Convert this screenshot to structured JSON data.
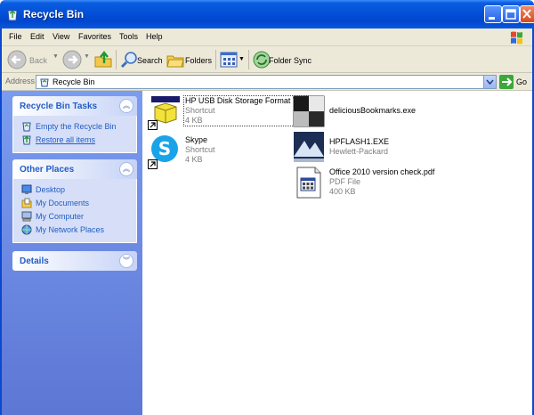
{
  "window": {
    "title": "Recycle Bin"
  },
  "menu": [
    "File",
    "Edit",
    "View",
    "Favorites",
    "Tools",
    "Help"
  ],
  "toolbar": {
    "back_label": "Back",
    "search_label": "Search",
    "folders_label": "Folders",
    "folder_sync_label": "Folder Sync"
  },
  "address": {
    "label": "Address",
    "value": "Recycle Bin",
    "go_label": "Go"
  },
  "taskpane": {
    "recycle_tasks": {
      "title": "Recycle Bin Tasks",
      "items": [
        {
          "label": "Empty the Recycle Bin",
          "icon": "empty-bin-icon"
        },
        {
          "label": "Restore all items",
          "icon": "restore-icon"
        }
      ]
    },
    "other_places": {
      "title": "Other Places",
      "items": [
        {
          "label": "Desktop",
          "icon": "desktop-icon"
        },
        {
          "label": "My Documents",
          "icon": "my-documents-icon"
        },
        {
          "label": "My Computer",
          "icon": "my-computer-icon"
        },
        {
          "label": "My Network Places",
          "icon": "network-places-icon"
        }
      ]
    },
    "details": {
      "title": "Details"
    }
  },
  "files": [
    {
      "name": "HP USB Disk Storage Format Tool",
      "type": "Shortcut",
      "size": "4 KB",
      "icon": "hp-usb-tool-icon"
    },
    {
      "name": "deliciousBookmarks.exe",
      "type": "",
      "size": "",
      "icon": "exe-icon"
    },
    {
      "name": "Skype",
      "type": "Shortcut",
      "size": "4 KB",
      "icon": "skype-icon"
    },
    {
      "name": "HPFLASH1.EXE",
      "type": "Hewlett-Packard",
      "size": "",
      "icon": "hp-flash-icon"
    },
    {
      "name": "Office 2010 version check.pdf",
      "type": "PDF File",
      "size": "400 KB",
      "icon": "pdf-file-icon"
    }
  ],
  "colors": {
    "title_bar": "#0350d8",
    "task_pane": "#6f8de6",
    "link": "#215dc6"
  }
}
